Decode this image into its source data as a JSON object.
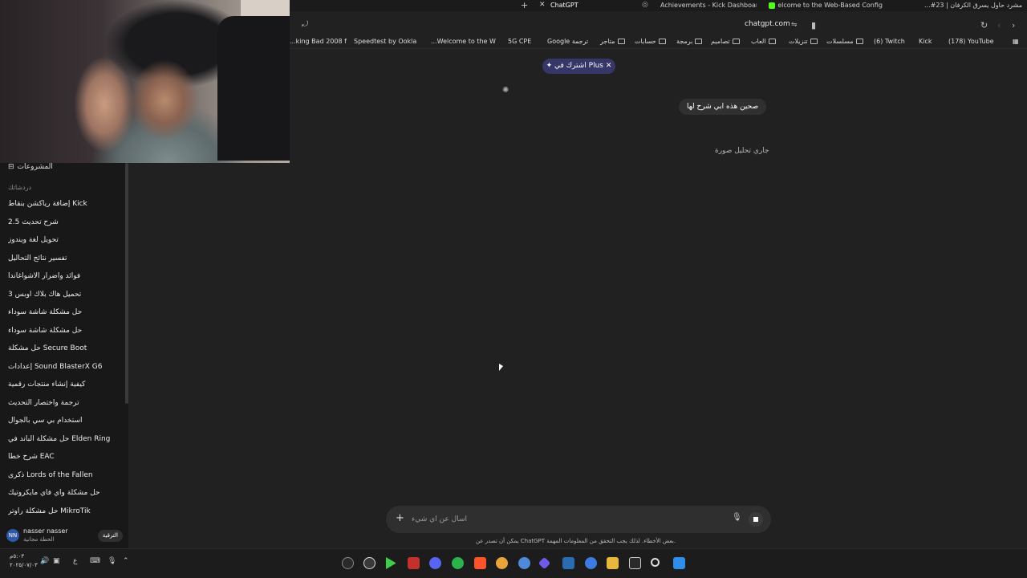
{
  "tabs": [
    {
      "title": "مشرد حاول يسرق الكرفان | 23#... ",
      "active": false
    },
    {
      "title": "Welcome to the Web-Based Config...",
      "active": false
    },
    {
      "title": "Achievements - Kick Dashboard",
      "active": false
    },
    {
      "title": "ChatGPT",
      "active": true
    }
  ],
  "address_bar": {
    "url": "chatgpt.com"
  },
  "bookmarks": [
    "(178) YouTube",
    "Kick",
    "(6) Twitch",
    "مسلسلات",
    "تنزيلات",
    "العاب",
    "تصاميم",
    "برمجة",
    "حسابات",
    "متاجر",
    "Google ترجمة",
    "5G CPE",
    "...Welcome to the W",
    "Speedtest by Ookla",
    "...king Bad 2008 f"
  ],
  "sidebar": {
    "projects_label": "المشروعات",
    "chats_heading": "دردشاتك",
    "chats": [
      "إضافة رياكشن بنقاط Kick",
      "شرح تحديث 2.5",
      "تحويل لغة ويندوز",
      "تفسير نتائج التحاليل",
      "فوائد وأضرار الأشواغاندا",
      "تحميل هاك بلاك اوبس 3",
      "حل مشكلة شاشة سوداء",
      "حل مشكلة شاشة سوداء",
      "حل مشكلة Secure Boot",
      "إعدادات Sound BlasterX G6",
      "كيفية إنشاء منتجات رقمية",
      "ترجمة واختصار التحديث",
      "استخدام بي سي بالجوال",
      "حل مشكلة الباند في Elden Ring",
      "شرح خطأ EAC",
      "ذكرى Lords of the Fallen",
      "حل مشكلة واي فاي مايكروتيك",
      "حل مشكلة راوتر MikroTik"
    ],
    "user": {
      "initials": "NN",
      "name": "nasser nasser",
      "plan": "الخطة مجانية",
      "upgrade_label": "الترقية"
    }
  },
  "main": {
    "upgrade_pill": "اشترك في Plus",
    "user_message": "صحين هذه ابي شرح لها",
    "status": "جاري تحليل صورة"
  },
  "composer": {
    "placeholder": "اسأل عن أي شيء",
    "disclaimer": "يمكن أن تصدر عن ChatGPT بعض الأخطاء. لذلك يجب التحقق من المعلومات المهمة."
  },
  "taskbar": {
    "time": "٥:٠٣م",
    "date": "٢٠٢٥/٠٧/٠٣",
    "lang": "ع"
  },
  "colors": {
    "background": "#212121",
    "sidebar": "#181818",
    "pill": "#373669",
    "bubble": "#303030"
  }
}
